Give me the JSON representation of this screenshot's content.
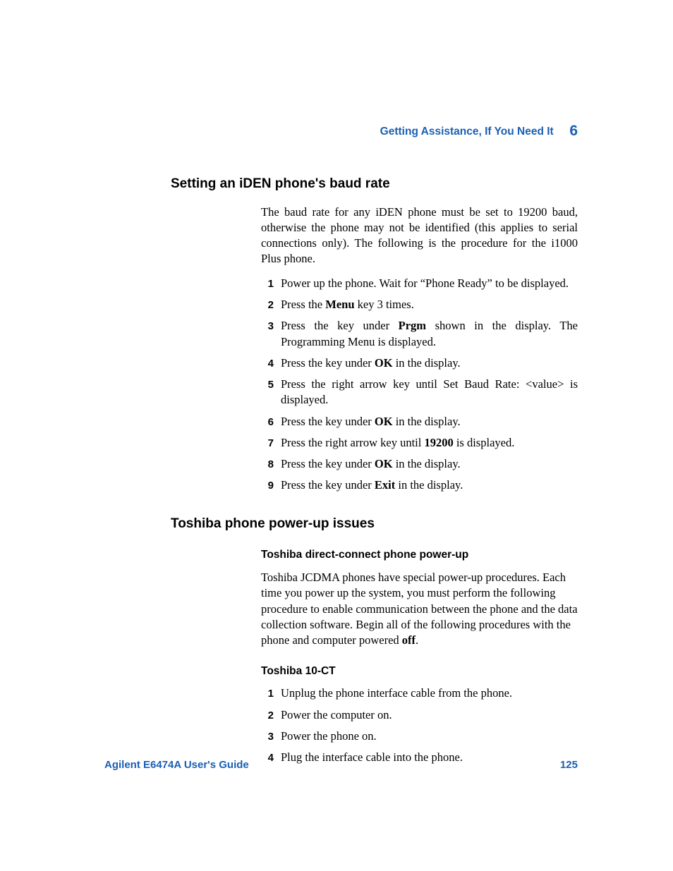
{
  "header": {
    "title": "Getting Assistance, If You Need It",
    "chapter": "6"
  },
  "footer": {
    "guide": "Agilent E6474A User's Guide",
    "page": "125"
  },
  "section1": {
    "heading": "Setting an iDEN phone's baud rate",
    "intro": "The baud rate for any iDEN phone must be set to 19200 baud, otherwise the phone may not be identified (this applies to serial connections only). The following is the procedure for the i1000 Plus phone.",
    "steps": {
      "n1": "1",
      "n2": "2",
      "n3": "3",
      "n4": "4",
      "n5": "5",
      "n6": "6",
      "n7": "7",
      "n8": "8",
      "n9": "9",
      "s1": "Power up the phone. Wait for “Phone Ready” to be displayed.",
      "s2a": "Press the ",
      "s2b": "Menu",
      "s2c": " key 3 times.",
      "s3a": "Press the key under ",
      "s3b": "Prgm",
      "s3c": " shown in the display. The Programming Menu is displayed.",
      "s4a": "Press the key under ",
      "s4b": "OK",
      "s4c": " in the display.",
      "s5": "Press the right arrow key until Set Baud Rate: <value> is displayed.",
      "s6a": "Press the key under ",
      "s6b": "OK",
      "s6c": " in the display.",
      "s7a": "Press the right arrow key until ",
      "s7b": "19200",
      "s7c": " is displayed.",
      "s8a": "Press the key under ",
      "s8b": "OK",
      "s8c": " in the display.",
      "s9a": "Press the key under ",
      "s9b": "Exit",
      "s9c": " in the display."
    }
  },
  "section2": {
    "heading": "Toshiba phone power-up issues",
    "sub1": {
      "heading": "Toshiba direct-connect phone power-up",
      "para_a": "Toshiba JCDMA phones have special power-up procedures. Each time you power up the system, you must perform the following procedure to enable communication between the phone and the data collection software. Begin all of the following procedures with the phone and computer powered ",
      "para_b": "off",
      "para_c": "."
    },
    "sub2": {
      "heading": "Toshiba 10-CT",
      "steps": {
        "n1": "1",
        "n2": "2",
        "n3": "3",
        "n4": "4",
        "s1": "Unplug the phone interface cable from the phone.",
        "s2": "Power the computer on.",
        "s3": "Power the phone on.",
        "s4": "Plug the interface cable into the phone."
      }
    }
  }
}
